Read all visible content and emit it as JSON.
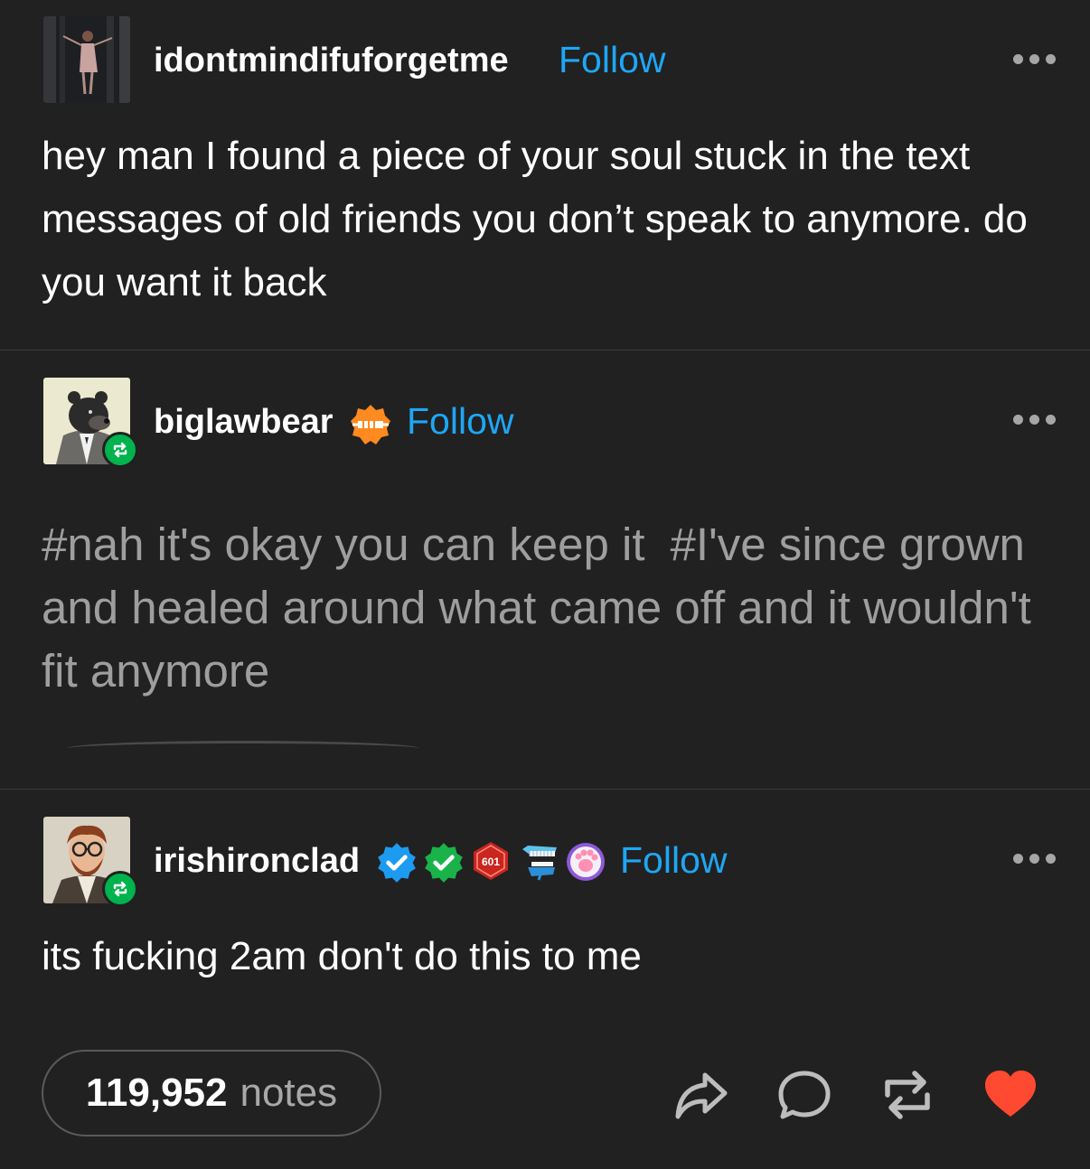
{
  "posts": [
    {
      "username": "idontmindifuforgetme",
      "follow_label": "Follow",
      "text": "hey man I found a piece of your soul stuck in the text messages of old friends you don’t speak to anymore. do you want it back"
    },
    {
      "username": "biglawbear",
      "follow_label": "Follow",
      "tags": [
        "#nah it's okay you can keep it",
        "#I've since grown and healed around what came off and it wouldn't fit anymore"
      ]
    },
    {
      "username": "irishironclad",
      "follow_label": "Follow",
      "badge_text": "601",
      "text": "its fucking 2am don't do this to me"
    }
  ],
  "footer": {
    "notes_count": "119,952",
    "notes_label": "notes"
  },
  "colors": {
    "background": "#212121",
    "follow": "#1ea7f5",
    "reblog_green": "#00b34d",
    "like_red": "#ff4930",
    "tag_gray": "#9e9e9e"
  },
  "icons": [
    "share-icon",
    "reply-icon",
    "reblog-icon",
    "like-icon",
    "more-options-icon",
    "verified-icon"
  ]
}
